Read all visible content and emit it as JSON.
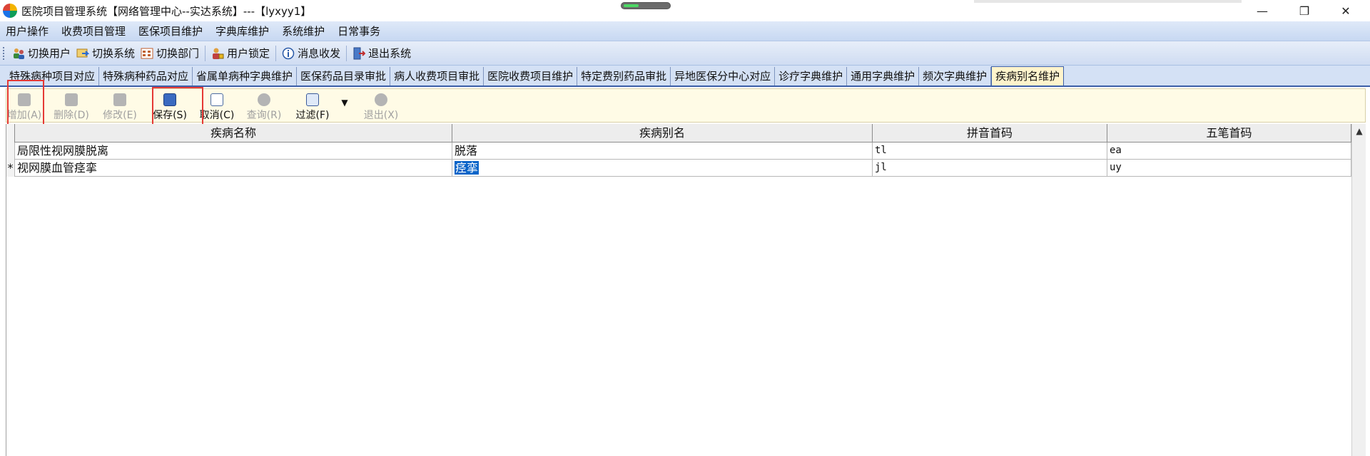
{
  "window": {
    "title": "医院项目管理系统【网络管理中心--实达系统】---【lyxyy1】",
    "minimize": "—",
    "restore": "❐",
    "close": "✕",
    "loading_progress": 0.33
  },
  "menu": [
    "用户操作",
    "收费项目管理",
    "医保项目维护",
    "字典库维护",
    "系统维护",
    "日常事务"
  ],
  "toolbar": {
    "switch_user": "切换用户",
    "switch_system": "切换系统",
    "switch_dept": "切换部门",
    "user_lock": "用户锁定",
    "messages": "消息收发",
    "exit_system": "退出系统"
  },
  "tabs": [
    "特殊病种项目对应",
    "特殊病种药品对应",
    "省属单病种字典维护",
    "医保药品目录审批",
    "病人收费项目审批",
    "医院收费项目维护",
    "特定费别药品审批",
    "异地医保分中心对应",
    "诊疗字典维护",
    "通用字典维护",
    "频次字典维护",
    "疾病别名维护"
  ],
  "active_tab": "疾病别名维护",
  "actions": {
    "add": "增加(A)",
    "delete": "删除(D)",
    "modify": "修改(E)",
    "save": "保存(S)",
    "cancel": "取消(C)",
    "query": "查询(R)",
    "filter": "过滤(F)",
    "filter_dropdown": "▼",
    "exit": "退出(X)"
  },
  "grid": {
    "columns": [
      "疾病名称",
      "疾病别名",
      "拼音首码",
      "五笔首码"
    ],
    "rows": [
      {
        "indicator": "",
        "name": "局限性视网膜脱离",
        "alias": "脱落",
        "pinyin": "tl",
        "wubi": "ea"
      },
      {
        "indicator": "*",
        "name": "视网膜血管痉挛",
        "alias": "痉挛",
        "pinyin": "jl",
        "wubi": "uy"
      }
    ]
  },
  "scroll_up": "▲"
}
